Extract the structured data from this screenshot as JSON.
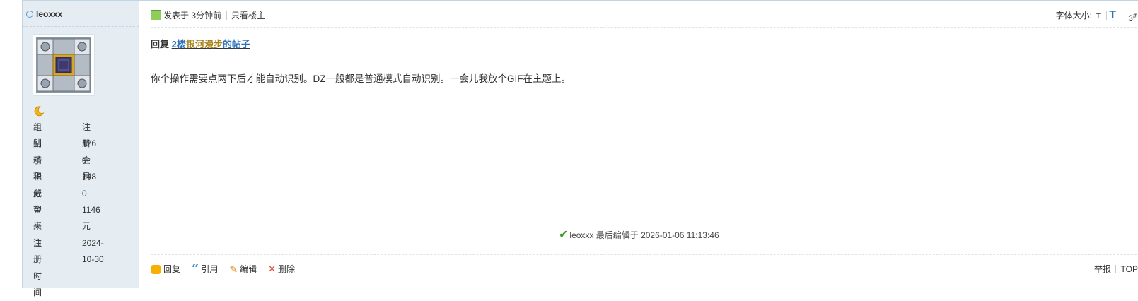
{
  "user": {
    "username": "leoxxx",
    "stats": [
      {
        "label": "组别",
        "value": "注册会员"
      },
      {
        "label": "帖子",
        "value": "126"
      },
      {
        "label": "精华",
        "value": "0"
      },
      {
        "label": "积分",
        "value": "148"
      },
      {
        "label": "威望",
        "value": "0"
      },
      {
        "label": "金币",
        "value": "1146 元"
      },
      {
        "label": "来自",
        "value": ""
      },
      {
        "label": "注册时间",
        "value": "2024-10-30"
      }
    ]
  },
  "post": {
    "posted_time": "发表于 3分钟前",
    "only_op": "只看楼主",
    "font_size_label": "字体大小:",
    "font_small": "T",
    "font_large": "T",
    "floor_number": "3",
    "floor_suffix": "#",
    "quote_prefix": "回复",
    "quote_floor": "2楼",
    "quote_user": "银河漫步",
    "quote_suffix": "的帖子",
    "content": "你个操作需要点两下后才能自动识别。DZ一般都是普通模式自动识别。一会儿我放个GIF在主题上。",
    "edit_note": "leoxxx 最后编辑于 2026-01-06 11:13:46"
  },
  "actions": {
    "reply": "回复",
    "quote": "引用",
    "edit": "编辑",
    "delete": "删除",
    "report": "举报",
    "top": "TOP"
  },
  "colors": {
    "sidebar_bg": "#e5edf2",
    "link_blue": "#2f74b8",
    "username_gold": "#a7831a"
  },
  "icons": [
    "online-status-icon",
    "crescent-moon-icon",
    "user-icon",
    "reply-icon",
    "quote-icon",
    "pencil-icon",
    "delete-icon",
    "check-icon"
  ]
}
